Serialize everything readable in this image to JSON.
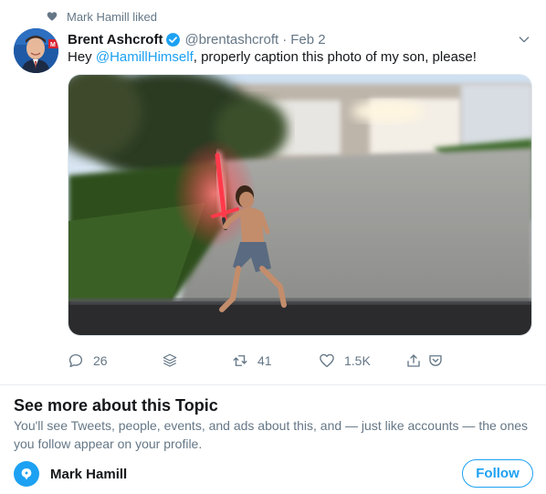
{
  "social_context": {
    "icon": "heart-icon",
    "text": "Mark Hamill liked"
  },
  "tweet": {
    "author_name": "Brent Ashcroft",
    "verified_icon": "verified-badge-icon",
    "handle": "@brentashcroft",
    "separator": "·",
    "date": "Feb 2",
    "text_prefix": "Hey ",
    "mention": "@HamillHimself",
    "text_suffix": ", properly caption this photo of my son, please!",
    "media_icon": "photo-boy-with-lightsaber",
    "actions": {
      "reply_count": "26",
      "retweet_count": "41",
      "like_count": "1.5K"
    }
  },
  "topic": {
    "title": "See more about this Topic",
    "description": "You'll see Tweets, people, events, and ads about this, and — just like accounts — the ones you follow appear on your profile.",
    "name": "Mark Hamill",
    "follow_label": "Follow"
  },
  "colors": {
    "accent": "#1da1f2",
    "muted": "#657786",
    "text": "#14171a",
    "lightsaber": "#ff3a4a"
  }
}
